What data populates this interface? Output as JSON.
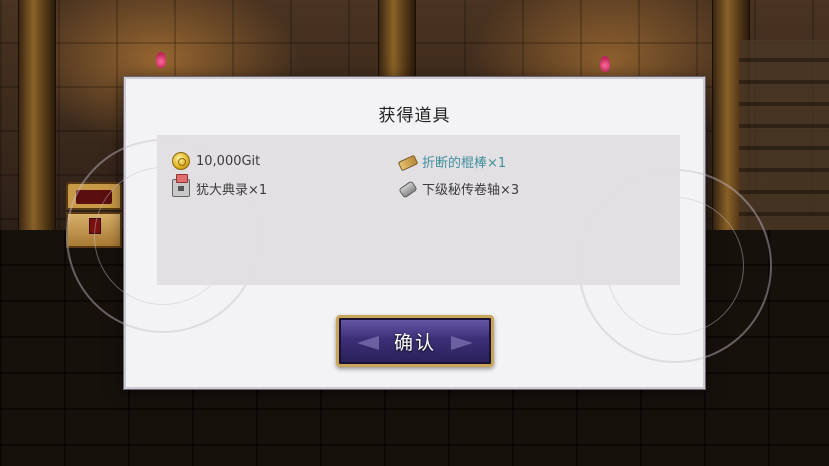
{
  "dialog": {
    "title": "获得道具",
    "items": [
      {
        "icon": "coin-icon",
        "label": "10,000Git",
        "highlight": false
      },
      {
        "icon": "broken-stick-icon",
        "label": "折断的棍棒×1",
        "highlight": true
      },
      {
        "icon": "book-icon",
        "label": "犹大典录×1",
        "highlight": false
      },
      {
        "icon": "scroll-icon",
        "label": "下级秘传卷轴×3",
        "highlight": false
      }
    ],
    "confirm_label": "确认"
  },
  "colors": {
    "highlight_text": "#3f8f9c",
    "button_border": "#c9a55a",
    "button_fill": "#3c2f78"
  }
}
